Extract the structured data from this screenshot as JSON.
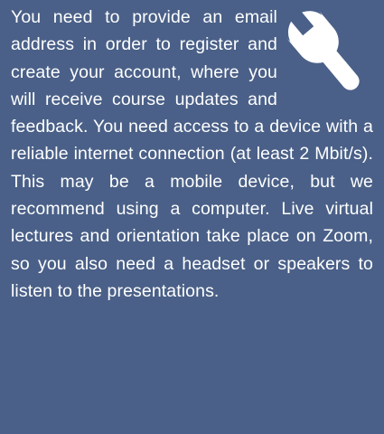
{
  "panel": {
    "icon": "wrench-icon",
    "colors": {
      "background": "#4a6088",
      "text": "#ffffff",
      "icon": "#ffffff"
    },
    "text": "You need to provide an email address in order to register and create your account, where you will receive course updates and feedback. You need access to a device with a reliable internet connection (at least 2 Mbit/s). This may be a mobile device, but we recommend using a computer. Live virtual lectures and orientation take place on Zoom, so you also need a headset or speakers to listen to the presentations."
  }
}
